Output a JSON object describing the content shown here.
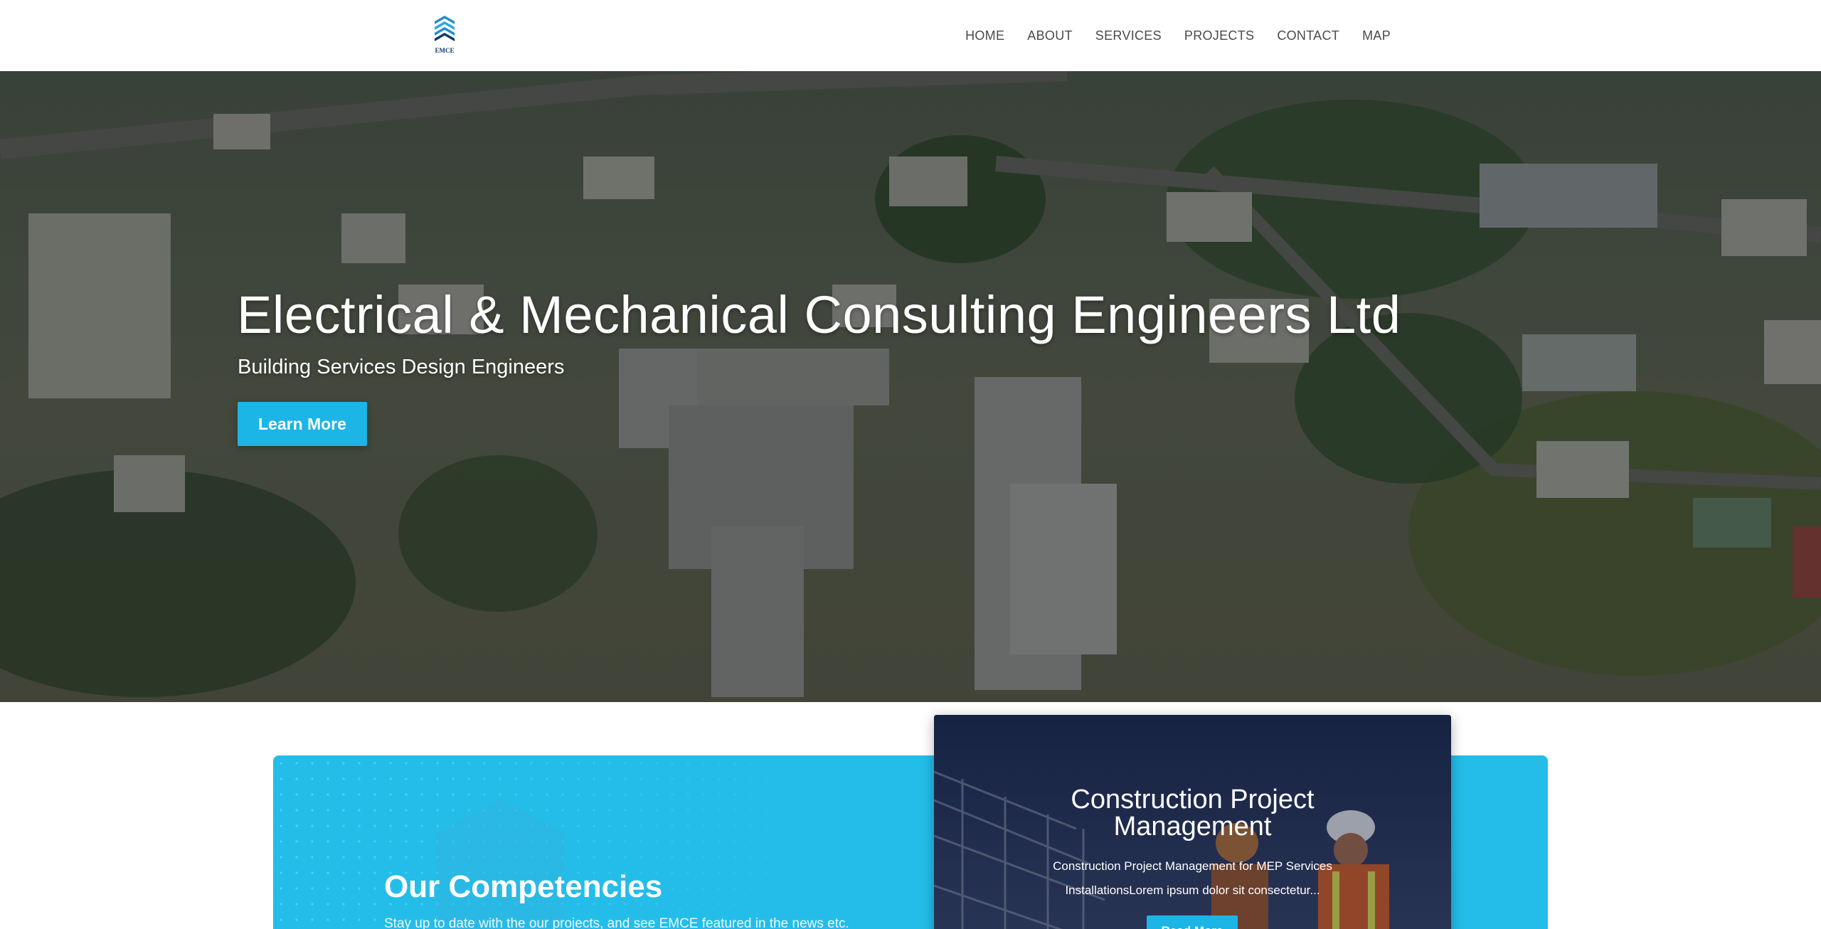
{
  "header": {
    "logo_text": "EMCE",
    "nav": [
      "HOME",
      "ABOUT",
      "SERVICES",
      "PROJECTS",
      "CONTACT",
      "MAP"
    ]
  },
  "hero": {
    "title": "Electrical & Mechanical Consulting Engineers Ltd",
    "subtitle": "Building Services Design Engineers",
    "button_label": "Learn More"
  },
  "competencies": {
    "title": "Our Competencies",
    "description": "Stay up to date with the our projects, and see EMCE featured in the news etc."
  },
  "project_card": {
    "title_line1": "Construction Project",
    "title_line2": "Management",
    "desc_line1": "Construction Project Management for MEP Services",
    "desc_line2": "InstallationsLorem ipsum dolor sit consectetur...",
    "button_label": "Read More"
  },
  "colors": {
    "accent": "#1bb5e6",
    "band": "#24bde9",
    "card": "#1f2b4a",
    "nav_text": "#4a4a4a"
  },
  "icons": [
    "emce-logo-icon"
  ]
}
